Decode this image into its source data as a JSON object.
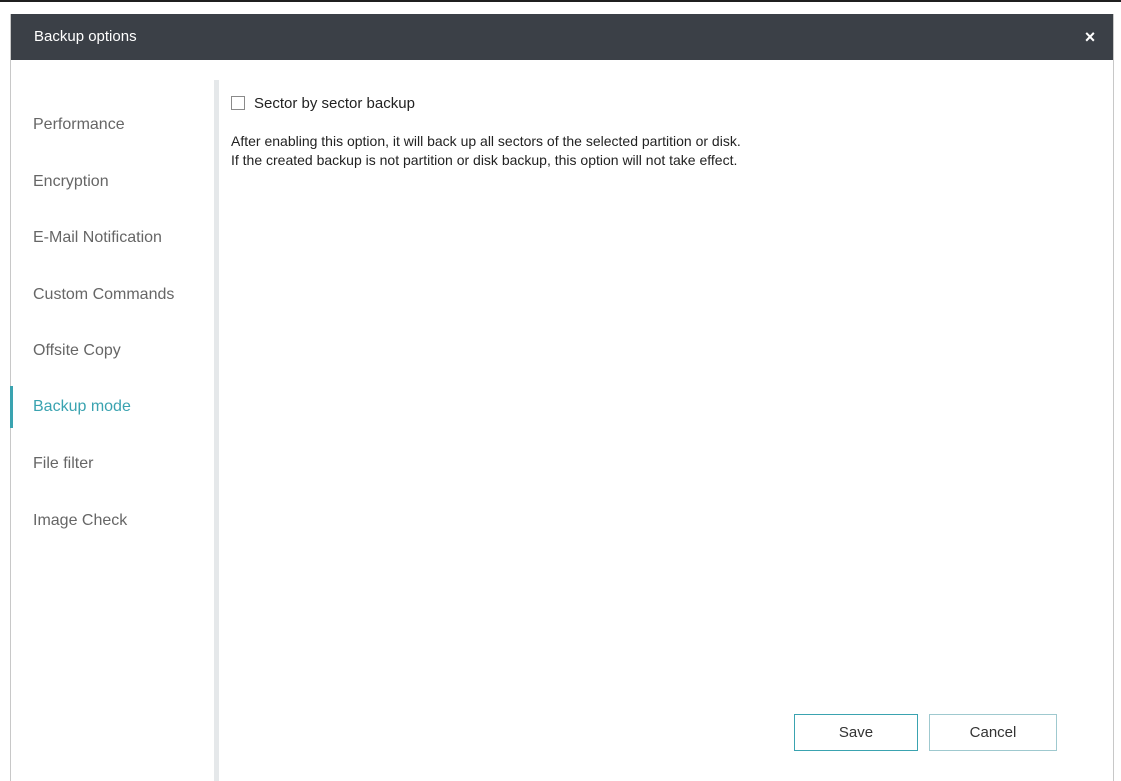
{
  "window": {
    "title": "Backup options",
    "close_icon": "×"
  },
  "sidebar": {
    "items": [
      {
        "label": "Performance"
      },
      {
        "label": "Encryption"
      },
      {
        "label": "E-Mail Notification"
      },
      {
        "label": "Custom Commands"
      },
      {
        "label": "Offsite Copy"
      },
      {
        "label": "Backup mode",
        "active": true
      },
      {
        "label": "File filter"
      },
      {
        "label": "Image Check"
      }
    ]
  },
  "content": {
    "option_label": "Sector by sector backup",
    "option_checked": false,
    "description_line1": "After enabling this option, it will back up all sectors of the selected partition or disk.",
    "description_line2": "If the created backup is not partition or disk backup, this option will not take effect."
  },
  "buttons": {
    "save": "Save",
    "cancel": "Cancel"
  },
  "colors": {
    "titlebar": "#3b4047",
    "accent": "#3aa3b0"
  }
}
